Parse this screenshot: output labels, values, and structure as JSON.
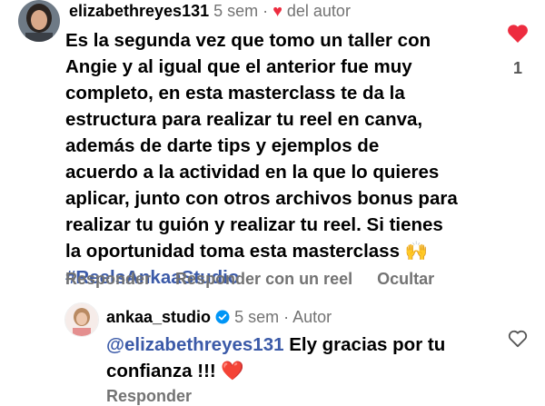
{
  "comment": {
    "username": "elizabethreyes131",
    "time": "5 sem",
    "separator": "·",
    "liked_by_author": "del autor",
    "text_lines": [
      "Es la segunda vez que tomo un taller con",
      "Angie y al igual que el anterior fue muy",
      "completo, en esta masterclass te da la",
      "estructura para realizar tu reel en canva,",
      "además de darte tips y ejemplos de",
      "acuerdo a la actividad en la que lo quieres",
      "aplicar, junto con otros archivos bonus para",
      "realizar tu guión y realizar tu reel. Si tienes",
      "la oportunidad toma esta masterclass"
    ],
    "emoji_end": "🙌",
    "hashtag": "#ReelsAnkaaStudio",
    "like_count": "1",
    "actions": {
      "reply": "Responder",
      "reply_reel": "Responder con un reel",
      "hide": "Ocultar"
    }
  },
  "reply": {
    "username": "ankaa_studio",
    "time": "5 sem",
    "separator": "·",
    "author_label": "Autor",
    "mention": "@elizabethreyes131",
    "text_1": " Ely gracias por tu",
    "text_2": "confianza !!!",
    "heart_emoji": "❤️",
    "actions": {
      "reply": "Responder"
    }
  },
  "colors": {
    "like_red": "#ed2c3f",
    "meta_gray": "#737373",
    "link_blue": "#3b5aa8",
    "verified_blue": "#0095f6"
  }
}
